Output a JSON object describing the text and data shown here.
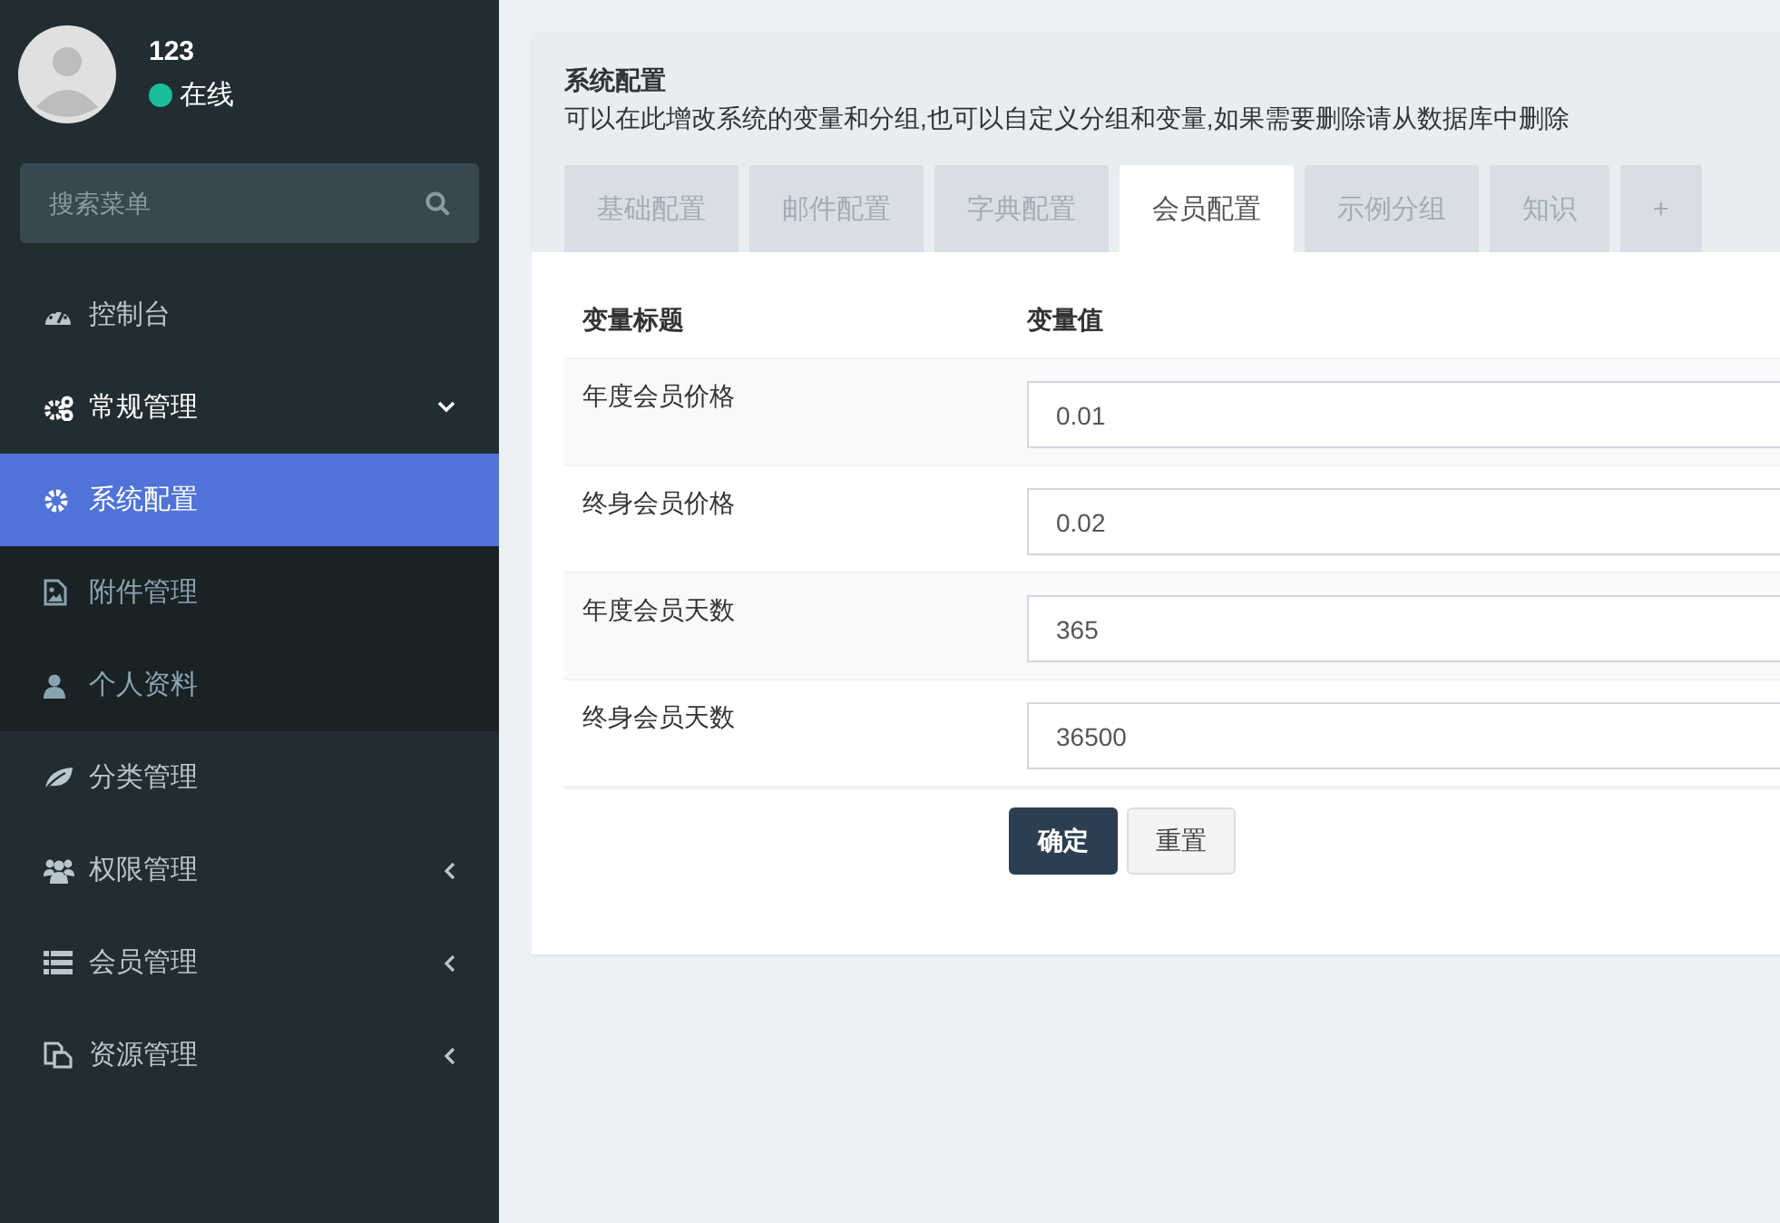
{
  "user": {
    "name": "123",
    "status": "在线"
  },
  "search": {
    "placeholder": "搜索菜单"
  },
  "menu": [
    {
      "label": "控制台",
      "selected": false
    },
    {
      "label": "常规管理",
      "selected": false,
      "expanded": true,
      "children": [
        {
          "label": "系统配置",
          "selected": true
        },
        {
          "label": "附件管理",
          "selected": false
        },
        {
          "label": "个人资料",
          "selected": false
        }
      ]
    },
    {
      "label": "分类管理",
      "selected": false
    },
    {
      "label": "权限管理",
      "selected": false,
      "expanded": false
    },
    {
      "label": "会员管理",
      "selected": false,
      "expanded": false
    },
    {
      "label": "资源管理",
      "selected": false,
      "expanded": false
    }
  ],
  "panel": {
    "title": "系统配置",
    "description": "可以在此增改系统的变量和分组,也可以自定义分组和变量,如果需要删除请从数据库中删除"
  },
  "tabs": [
    {
      "label": "基础配置",
      "selected": false
    },
    {
      "label": "邮件配置",
      "selected": false
    },
    {
      "label": "字典配置",
      "selected": false
    },
    {
      "label": "会员配置",
      "selected": true
    },
    {
      "label": "示例分组",
      "selected": false
    },
    {
      "label": "知识",
      "selected": false
    },
    {
      "label": "+",
      "selected": false
    }
  ],
  "table": {
    "columns": [
      "变量标题",
      "变量值"
    ],
    "rows": [
      {
        "title": "年度会员价格",
        "value": "0.01"
      },
      {
        "title": "终身会员价格",
        "value": "0.02"
      },
      {
        "title": "年度会员天数",
        "value": "365"
      },
      {
        "title": "终身会员天数",
        "value": "36500"
      }
    ]
  },
  "buttons": [
    "确定",
    "重置"
  ]
}
